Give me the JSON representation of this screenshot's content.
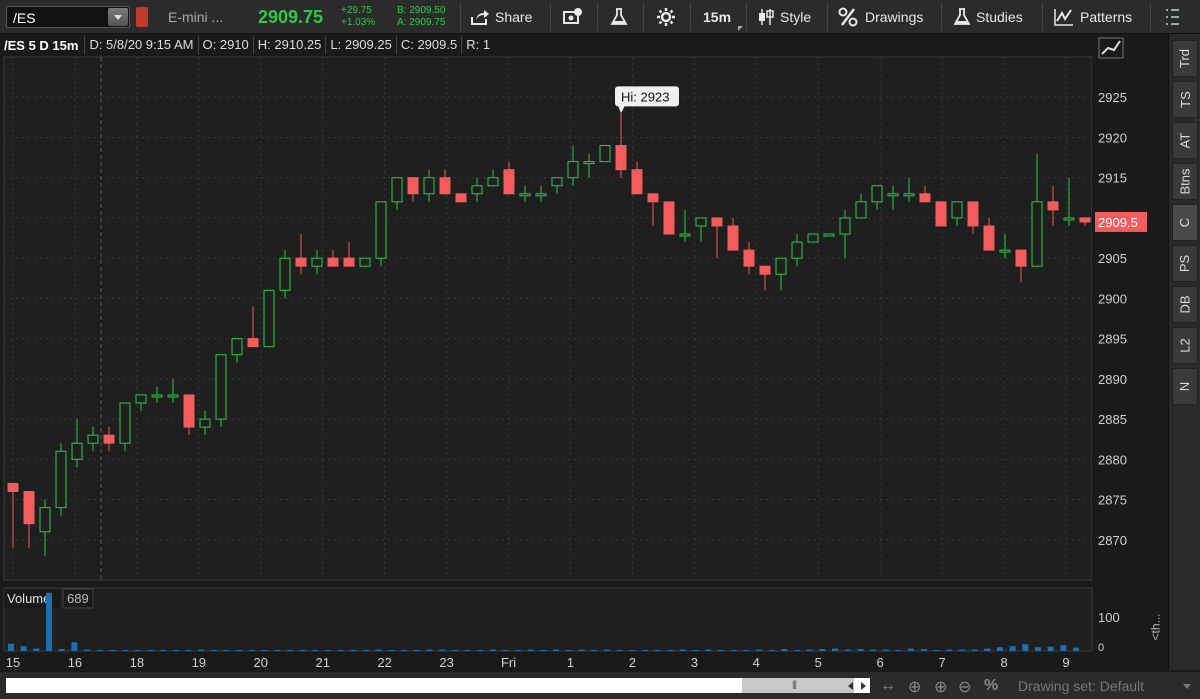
{
  "toolbar": {
    "symbol": "/ES",
    "description": "E-mini ...",
    "last_price": "2909.75",
    "net_change": "+29.75",
    "pct_change": "+1.03%",
    "bid": "B: 2909.50",
    "ask": "A: 2909.75",
    "share_label": "Share",
    "timeframe_label": "15m",
    "style_label": "Style",
    "drawings_label": "Drawings",
    "studies_label": "Studies",
    "patterns_label": "Patterns",
    "icons": [
      "share-icon",
      "snapshot-icon",
      "flask-icon",
      "gear-icon",
      "candlestick-icon",
      "percent-icon",
      "studies-flask-icon",
      "patterns-icon",
      "grid-menu-icon"
    ]
  },
  "infobar": {
    "symbol": "/ES 5 D 15m",
    "date": "D: 5/8/20 9:15 AM",
    "open": "O: 2910",
    "high": "H: 2910.25",
    "low": "L: 2909.25",
    "close": "C: 2909.5",
    "range": "R: 1"
  },
  "sidebar": {
    "tabs": [
      "Trd",
      "TS",
      "AT",
      "Btns",
      "C",
      "PS",
      "DB",
      "L2",
      "N"
    ],
    "active": "C",
    "collapse_label": "<th..."
  },
  "volume_panel": {
    "label": "Volume",
    "value": "689",
    "axis_label": "100",
    "axis_zero": "0"
  },
  "bottom_bar": {
    "drawing_set_label": "Drawing set: Default"
  },
  "colors": {
    "up": "#2ec84a",
    "down": "#f25c5c",
    "background": "#1a1a1a",
    "grid": "#3a3a3a",
    "price_tag": "#f25c5c"
  },
  "chart_data": {
    "type": "candlestick",
    "current_price_tag": "2909.5",
    "high_annotation": "Hi: 2923",
    "ylim": [
      2865,
      2930
    ],
    "y_ticks": [
      2870,
      2875,
      2880,
      2885,
      2890,
      2895,
      2900,
      2905,
      2910,
      2915,
      2920,
      2925
    ],
    "x_tick_labels": [
      "15",
      "16",
      "18",
      "19",
      "20",
      "21",
      "22",
      "23",
      "Fri",
      "1",
      "2",
      "3",
      "4",
      "5",
      "6",
      "7",
      "8",
      "9"
    ],
    "session_break_label": "16",
    "candles": [
      {
        "o": 2877,
        "h": 2877,
        "l": 2869,
        "c": 2876
      },
      {
        "o": 2876,
        "h": 2876,
        "l": 2869,
        "c": 2872
      },
      {
        "o": 2871,
        "h": 2875,
        "l": 2868,
        "c": 2874
      },
      {
        "o": 2874,
        "h": 2882,
        "l": 2873,
        "c": 2881
      },
      {
        "o": 2880,
        "h": 2885,
        "l": 2879,
        "c": 2882
      },
      {
        "o": 2882,
        "h": 2884,
        "l": 2881,
        "c": 2883
      },
      {
        "o": 2883,
        "h": 2884,
        "l": 2881,
        "c": 2882
      },
      {
        "o": 2882,
        "h": 2887,
        "l": 2881,
        "c": 2887
      },
      {
        "o": 2887,
        "h": 2888,
        "l": 2886,
        "c": 2888
      },
      {
        "o": 2888,
        "h": 2889,
        "l": 2887,
        "c": 2888
      },
      {
        "o": 2888,
        "h": 2890,
        "l": 2887,
        "c": 2888
      },
      {
        "o": 2888,
        "h": 2888,
        "l": 2883,
        "c": 2884
      },
      {
        "o": 2884,
        "h": 2886,
        "l": 2883,
        "c": 2885
      },
      {
        "o": 2885,
        "h": 2893,
        "l": 2884,
        "c": 2893
      },
      {
        "o": 2893,
        "h": 2895,
        "l": 2892,
        "c": 2895
      },
      {
        "o": 2895,
        "h": 2899,
        "l": 2894,
        "c": 2894
      },
      {
        "o": 2894,
        "h": 2901,
        "l": 2894,
        "c": 2901
      },
      {
        "o": 2901,
        "h": 2906,
        "l": 2900,
        "c": 2905
      },
      {
        "o": 2905,
        "h": 2908,
        "l": 2903,
        "c": 2904
      },
      {
        "o": 2904,
        "h": 2906,
        "l": 2903,
        "c": 2905
      },
      {
        "o": 2905,
        "h": 2906,
        "l": 2904,
        "c": 2904
      },
      {
        "o": 2905,
        "h": 2907,
        "l": 2904,
        "c": 2904
      },
      {
        "o": 2904,
        "h": 2905,
        "l": 2904,
        "c": 2905
      },
      {
        "o": 2905,
        "h": 2912,
        "l": 2904,
        "c": 2912
      },
      {
        "o": 2912,
        "h": 2915,
        "l": 2911,
        "c": 2915
      },
      {
        "o": 2915,
        "h": 2915,
        "l": 2912,
        "c": 2913
      },
      {
        "o": 2913,
        "h": 2916,
        "l": 2912,
        "c": 2915
      },
      {
        "o": 2915,
        "h": 2916,
        "l": 2913,
        "c": 2913
      },
      {
        "o": 2913,
        "h": 2913,
        "l": 2912,
        "c": 2912
      },
      {
        "o": 2913,
        "h": 2915,
        "l": 2912,
        "c": 2914
      },
      {
        "o": 2914,
        "h": 2916,
        "l": 2914,
        "c": 2915
      },
      {
        "o": 2916,
        "h": 2917,
        "l": 2913,
        "c": 2913
      },
      {
        "o": 2913,
        "h": 2914,
        "l": 2912,
        "c": 2913
      },
      {
        "o": 2913,
        "h": 2914,
        "l": 2912,
        "c": 2913
      },
      {
        "o": 2914,
        "h": 2915,
        "l": 2913,
        "c": 2915
      },
      {
        "o": 2915,
        "h": 2919,
        "l": 2914,
        "c": 2917
      },
      {
        "o": 2917,
        "h": 2918,
        "l": 2915,
        "c": 2917
      },
      {
        "o": 2917,
        "h": 2919,
        "l": 2917,
        "c": 2919
      },
      {
        "o": 2919,
        "h": 2923,
        "l": 2915,
        "c": 2916
      },
      {
        "o": 2916,
        "h": 2917,
        "l": 2913,
        "c": 2913
      },
      {
        "o": 2913,
        "h": 2913,
        "l": 2909,
        "c": 2912
      },
      {
        "o": 2912,
        "h": 2912,
        "l": 2908,
        "c": 2908
      },
      {
        "o": 2908,
        "h": 2911,
        "l": 2907,
        "c": 2908
      },
      {
        "o": 2909,
        "h": 2910,
        "l": 2907,
        "c": 2910
      },
      {
        "o": 2910,
        "h": 2910,
        "l": 2905,
        "c": 2909
      },
      {
        "o": 2909,
        "h": 2910,
        "l": 2906,
        "c": 2906
      },
      {
        "o": 2906,
        "h": 2907,
        "l": 2903,
        "c": 2904
      },
      {
        "o": 2904,
        "h": 2904,
        "l": 2901,
        "c": 2903
      },
      {
        "o": 2903,
        "h": 2905,
        "l": 2901,
        "c": 2905
      },
      {
        "o": 2905,
        "h": 2908,
        "l": 2904,
        "c": 2907
      },
      {
        "o": 2907,
        "h": 2908,
        "l": 2907,
        "c": 2908
      },
      {
        "o": 2908,
        "h": 2908,
        "l": 2908,
        "c": 2908
      },
      {
        "o": 2908,
        "h": 2911,
        "l": 2905,
        "c": 2910
      },
      {
        "o": 2910,
        "h": 2913,
        "l": 2910,
        "c": 2912
      },
      {
        "o": 2912,
        "h": 2914,
        "l": 2911,
        "c": 2914
      },
      {
        "o": 2913,
        "h": 2914,
        "l": 2911,
        "c": 2913
      },
      {
        "o": 2913,
        "h": 2915,
        "l": 2912,
        "c": 2913
      },
      {
        "o": 2913,
        "h": 2914,
        "l": 2912,
        "c": 2912
      },
      {
        "o": 2912,
        "h": 2912,
        "l": 2909,
        "c": 2909
      },
      {
        "o": 2910,
        "h": 2912,
        "l": 2909,
        "c": 2912
      },
      {
        "o": 2912,
        "h": 2912,
        "l": 2908,
        "c": 2909
      },
      {
        "o": 2909,
        "h": 2910,
        "l": 2906,
        "c": 2906
      },
      {
        "o": 2906,
        "h": 2908,
        "l": 2905,
        "c": 2906
      },
      {
        "o": 2906,
        "h": 2906,
        "l": 2902,
        "c": 2904
      },
      {
        "o": 2904,
        "h": 2918,
        "l": 2904,
        "c": 2912
      },
      {
        "o": 2912,
        "h": 2914,
        "l": 2909,
        "c": 2911
      },
      {
        "o": 2910,
        "h": 2915,
        "l": 2909,
        "c": 2910
      },
      {
        "o": 2910,
        "h": 2910,
        "l": 2909,
        "c": 2909.5
      }
    ],
    "volume": {
      "ylim": [
        0,
        130
      ],
      "values": [
        15,
        10,
        5,
        120,
        4,
        18,
        3,
        2,
        2,
        2,
        2,
        2,
        2,
        2,
        2,
        3,
        2,
        2,
        2,
        2,
        2,
        2,
        2,
        2,
        2,
        2,
        2,
        2,
        2,
        3,
        2,
        2,
        2,
        3,
        3,
        2,
        2,
        2,
        3,
        2,
        2,
        3,
        2,
        3,
        2,
        3,
        2,
        3,
        2,
        2,
        2,
        2,
        2,
        3,
        2,
        3,
        2,
        2,
        2,
        3,
        2,
        4,
        2,
        3,
        4,
        5,
        3,
        4,
        3,
        3,
        2,
        5,
        4,
        2,
        3,
        3,
        3,
        5,
        8,
        10,
        14,
        8,
        9,
        12,
        7
      ]
    }
  }
}
